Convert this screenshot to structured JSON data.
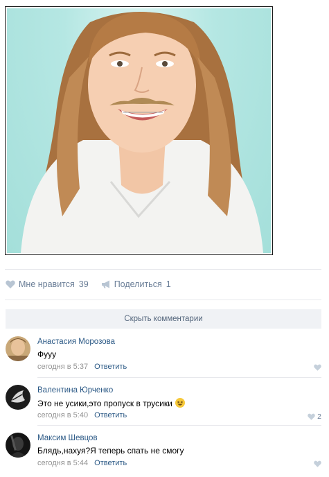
{
  "post": {
    "photo_alt_icon": "photo-girl-with-mustache"
  },
  "actions": {
    "like_label": "Мне нравится",
    "like_count": "39",
    "share_label": "Поделиться",
    "share_count": "1"
  },
  "comments_toggle": "Скрыть комментарии",
  "comments": [
    {
      "author": "Анастасия Морозова",
      "text": "Фууу",
      "time": "сегодня в 5:37",
      "reply": "Ответить",
      "likes": ""
    },
    {
      "author": "Валентина Юрченко",
      "text": "Это не усики,это пропуск в трусики",
      "time": "сегодня в 5:40",
      "reply": "Ответить",
      "likes": "2"
    },
    {
      "author": "Максим Шевцов",
      "text": "Блядь,нахуя?Я теперь спать не смогу",
      "time": "сегодня в 5:44",
      "reply": "Ответить",
      "likes": ""
    }
  ],
  "colors": {
    "link": "#2a5885",
    "meta": "#939393",
    "action": "#6a7e97",
    "bar": "#f0f2f5"
  }
}
